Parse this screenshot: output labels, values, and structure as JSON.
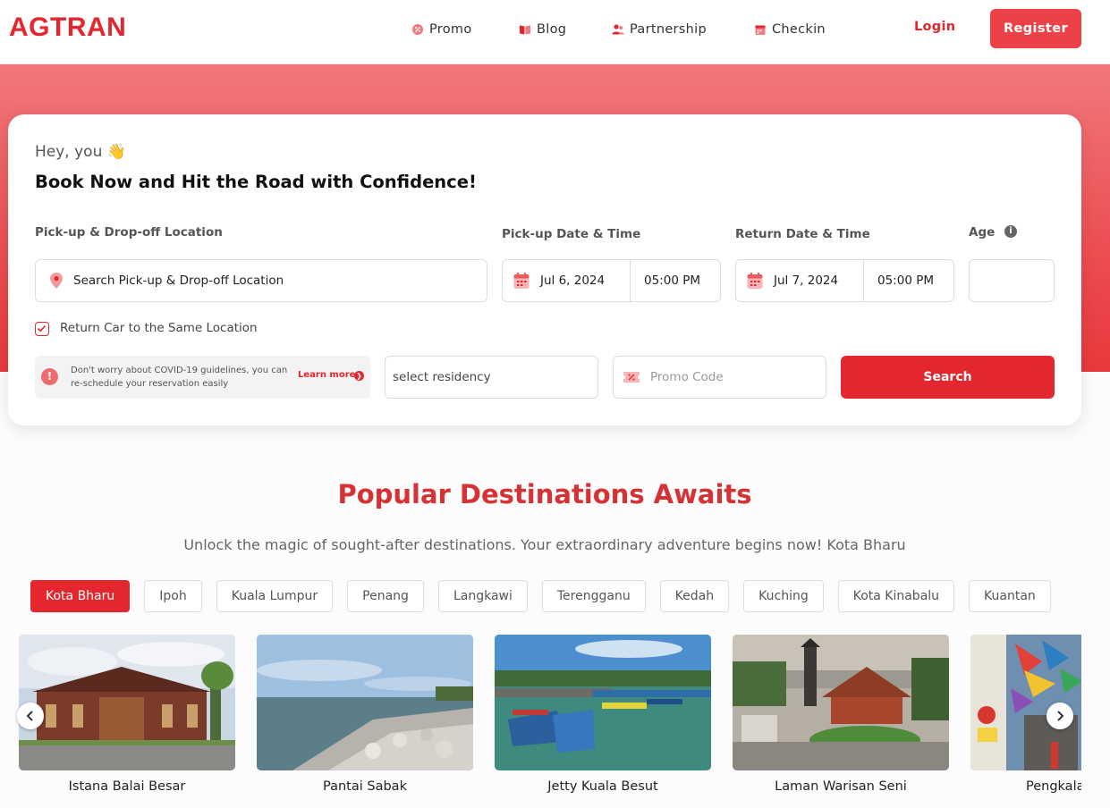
{
  "brand": {
    "logo": "AGTRAN"
  },
  "nav": {
    "promo": "Promo",
    "blog": "Blog",
    "partnership": "Partnership",
    "checkin": "Checkin",
    "login": "Login",
    "register": "Register"
  },
  "booking": {
    "greeting": "Hey, you 👋",
    "headline": "Book Now and Hit the Road with Confidence!",
    "location_label": "Pick-up & Drop-off Location",
    "location_placeholder": "Search Pick-up & Drop-off Location",
    "pickup_label": "Pick-up Date & Time",
    "pickup_date": "Jul 6, 2024",
    "pickup_time": "05:00 PM",
    "return_label": "Return Date & Time",
    "return_date": "Jul 7, 2024",
    "return_time": "05:00 PM",
    "age_label": "Age",
    "age_value": "",
    "same_location_label": "Return Car to the Same Location",
    "covid_message": "Don't worry about COVID-19 guidelines, you can re-schedule your reservation easily",
    "learn_more": "Learn more",
    "residency_placeholder": "select residency",
    "promo_placeholder": "Promo Code",
    "search_button": "Search"
  },
  "destinations": {
    "title": "Popular Destinations Awaits",
    "subtitle": "Unlock the magic of sought-after destinations. Your extraordinary adventure begins now! Kota Bharu",
    "chips": [
      "Kota Bharu",
      "Ipoh",
      "Kuala Lumpur",
      "Penang",
      "Langkawi",
      "Terengganu",
      "Kedah",
      "Kuching",
      "Kota Kinabalu",
      "Kuantan"
    ],
    "active_chip": "Kota Bharu",
    "cards": [
      {
        "name": "Istana Balai Besar"
      },
      {
        "name": "Pantai Sabak"
      },
      {
        "name": "Jetty Kuala Besut"
      },
      {
        "name": "Laman Warisan Seni"
      },
      {
        "name": "Pengkalan Kubor"
      }
    ]
  },
  "colors": {
    "brand_red": "#e4262e",
    "register_red": "#ec4146",
    "hero_top": "#f1787b",
    "hero_bottom": "#e8383d"
  },
  "icons": {
    "promo": "percent-badge-icon",
    "blog": "book-icon",
    "partnership": "users-icon",
    "checkin": "calendar-icon",
    "location": "map-pin-icon",
    "date": "calendar-icon",
    "info": "info-icon",
    "checkbox": "check-icon",
    "covid": "alert-icon",
    "learn_more": "chevron-right-icon",
    "promo_code": "ticket-icon",
    "carousel_prev": "chevron-left-icon",
    "carousel_next": "chevron-right-icon"
  }
}
